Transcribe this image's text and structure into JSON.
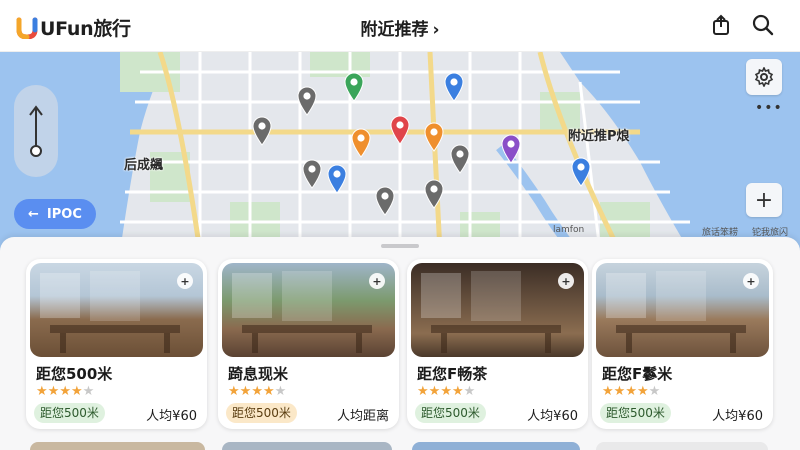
{
  "app": {
    "brand": "UFun旅行",
    "logo_letter": "U",
    "title": "附近推荐",
    "title_chevron": "›"
  },
  "header_icons": [
    "share-icon",
    "search-icon"
  ],
  "map": {
    "labels": {
      "district_west": "后成飊",
      "district_east": "附近推P烺",
      "road_small": "lamfon",
      "corner_a": "旅话笨耢",
      "corner_b": "铊我旅闪"
    },
    "back_button": "IPOC",
    "more": "•••",
    "zoom_in": "+",
    "pin_colors": {
      "gray": "#6b6b6b",
      "green": "#3aa55a",
      "blue": "#3b7fe0",
      "red": "#e0454a",
      "orange": "#ef8f2d",
      "purple": "#8a4fc8"
    }
  },
  "cards": [
    {
      "name": "距您500米",
      "rating": 4,
      "tag": "距您500米",
      "tag_style": "green",
      "price": "人均¥60",
      "fav": "+"
    },
    {
      "name": "踦息现米",
      "rating": 4,
      "tag": "距您500米",
      "tag_style": "orange",
      "price": "人均距离",
      "fav": "+"
    },
    {
      "name": "距您F畅茶",
      "rating": 4,
      "tag": "距您500米",
      "tag_style": "green",
      "price": "人均¥60",
      "fav": "+"
    },
    {
      "name": "距您F鬖米",
      "rating": 4,
      "tag": "距您500米",
      "tag_style": "green",
      "price": "人均¥60",
      "fav": "+"
    }
  ],
  "stars": {
    "on": "★",
    "off": "★"
  },
  "colors": {
    "accent_blue": "#5a8ef0",
    "star": "#f2a33a",
    "tag_green": "#dff1df",
    "tag_orange": "#fbe8c8"
  }
}
